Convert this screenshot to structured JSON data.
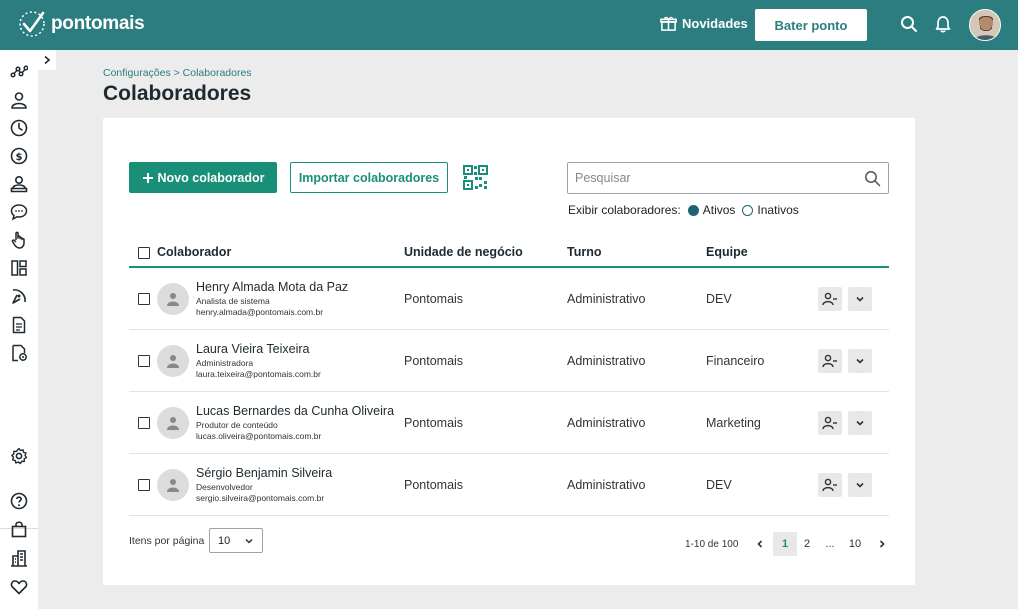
{
  "app": {
    "logo_text": "pontomais"
  },
  "topbar": {
    "novidades_label": "Novidades",
    "bater_ponto_label": "Bater ponto"
  },
  "breadcrumb": "Configurações > Colaboradores",
  "page_title": "Colaboradores",
  "toolbar": {
    "new_label": "Novo colaborador",
    "import_label": "Importar colaboradores",
    "search_placeholder": "Pesquisar"
  },
  "filter": {
    "label": "Exibir colaboradores:",
    "options": [
      {
        "label": "Ativos",
        "selected": true
      },
      {
        "label": "Inativos",
        "selected": false
      }
    ]
  },
  "table": {
    "columns": [
      "Colaborador",
      "Unidade de negócio",
      "Turno",
      "Equipe"
    ],
    "rows": [
      {
        "name": "Henry Almada Mota da Paz",
        "role": "Analista de sistema",
        "email": "henry.almada@pontomais.com.br",
        "unit": "Pontomais",
        "shift": "Administrativo",
        "team": "DEV"
      },
      {
        "name": "Laura Vieira Teixeira",
        "role": "Administradora",
        "email": "laura.teixeira@pontomais.com.br",
        "unit": "Pontomais",
        "shift": "Administrativo",
        "team": "Financeiro"
      },
      {
        "name": "Lucas Bernardes da Cunha Oliveira",
        "role": "Produtor de conteúdo",
        "email": "lucas.oliveira@pontomais.com.br",
        "unit": "Pontomais",
        "shift": "Administrativo",
        "team": "Marketing"
      },
      {
        "name": "Sérgio Benjamin Silveira",
        "role": "Desenvolvedor",
        "email": "sergio.silveira@pontomais.com.br",
        "unit": "Pontomais",
        "shift": "Administrativo",
        "team": "DEV"
      }
    ]
  },
  "footer": {
    "per_page_label": "Itens por página",
    "per_page_value": "10",
    "range": "1-10 de 100",
    "pages": [
      "1",
      "2",
      "...",
      "10"
    ]
  },
  "colors": {
    "topbar": "#2b7d80",
    "accent": "#1a8f78"
  },
  "icons": {
    "sidebar": [
      "dashboard-icon",
      "user-icon",
      "clock-icon",
      "money-icon",
      "users-icon",
      "chat-icon",
      "hand-icon",
      "layout-icon",
      "compass-icon",
      "document-icon",
      "document-settings-icon",
      "settings-icon",
      "help-icon",
      "bag-icon",
      "building-icon",
      "heart-icon"
    ]
  }
}
